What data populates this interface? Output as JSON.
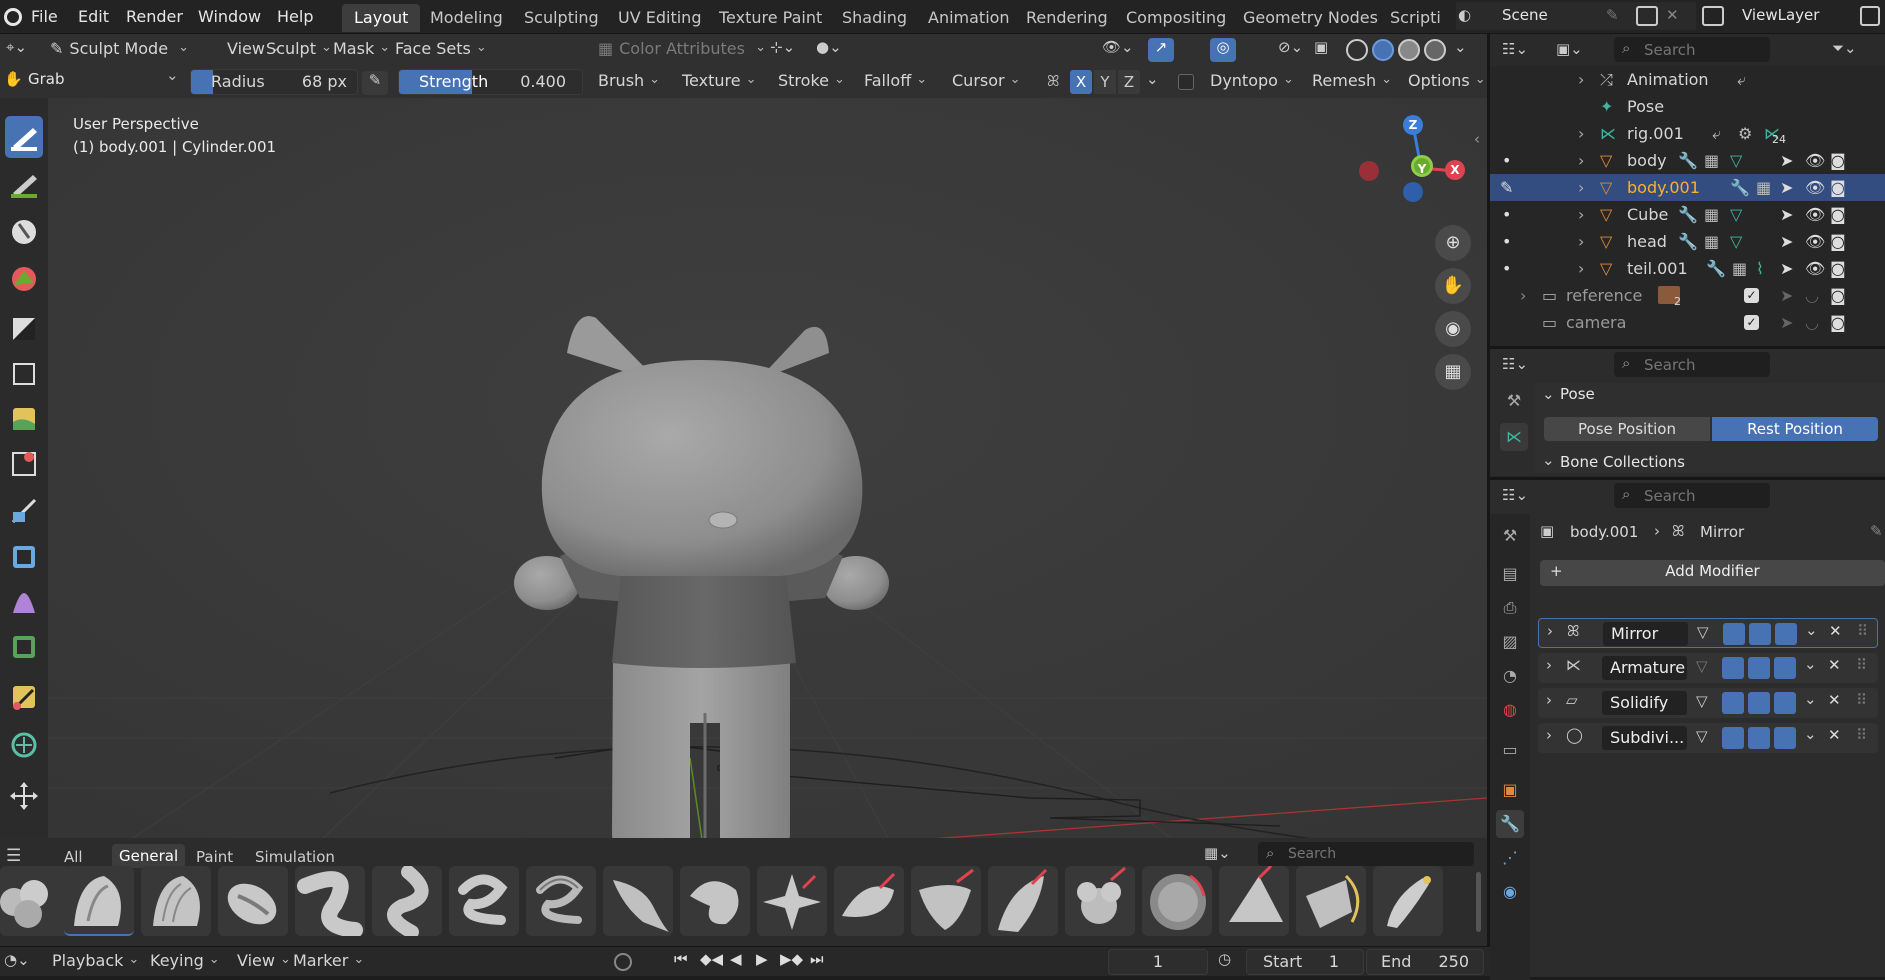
{
  "topmenu": {
    "items": [
      "File",
      "Edit",
      "Render",
      "Window",
      "Help"
    ]
  },
  "workspaces": {
    "tabs": [
      "Layout",
      "Modeling",
      "Sculpting",
      "UV Editing",
      "Texture Paint",
      "Shading",
      "Animation",
      "Rendering",
      "Compositing",
      "Geometry Nodes",
      "Scripti"
    ],
    "active": "Layout"
  },
  "scene": {
    "name": "Scene",
    "viewlayer": "ViewLayer"
  },
  "header": {
    "mode": "Sculpt Mode",
    "menus": [
      "View",
      "Sculpt",
      "Mask",
      "Face Sets"
    ],
    "color_attributes": "Color Attributes",
    "brush_name": "Grab",
    "radius_label": "Radius",
    "radius_value": "68 px",
    "strength_label": "Strength",
    "strength_value": "0.400",
    "strength_fraction": 0.4,
    "dropdowns": [
      "Brush",
      "Texture",
      "Stroke",
      "Falloff",
      "Cursor"
    ],
    "axes": [
      "X",
      "Y",
      "Z"
    ],
    "dyntopo": "Dyntopo",
    "remesh": "Remesh",
    "options": "Options"
  },
  "viewport": {
    "perspective": "User Perspective",
    "object_info": "(1) body.001 | Cylinder.001",
    "gizmo": {
      "z": "Z",
      "y": "Y",
      "x": "X"
    }
  },
  "brush_tabs": {
    "tabs": [
      "All",
      "General",
      "Paint",
      "Simulation"
    ],
    "active": "General",
    "search_placeholder": "Search"
  },
  "timeline": {
    "menus": [
      "Playback",
      "Keying",
      "View",
      "Marker"
    ],
    "current_frame": "1",
    "start_label": "Start",
    "start_value": "1",
    "end_label": "End",
    "end_value": "250"
  },
  "outliner": {
    "search_placeholder": "Search",
    "rows": [
      {
        "label": "Animation",
        "type": "anim",
        "badge": ""
      },
      {
        "label": "Pose",
        "type": "pose",
        "badge": ""
      },
      {
        "label": "rig.001",
        "type": "armature",
        "badge": "24"
      },
      {
        "label": "body",
        "type": "mesh",
        "badge": ""
      },
      {
        "label": "body.001",
        "type": "mesh",
        "badge": ""
      },
      {
        "label": "Cube",
        "type": "mesh",
        "badge": ""
      },
      {
        "label": "head",
        "type": "mesh",
        "badge": ""
      },
      {
        "label": "teil.001",
        "type": "mesh",
        "badge": ""
      },
      {
        "label": "reference",
        "type": "collection",
        "badge": "2"
      },
      {
        "label": "camera",
        "type": "collection",
        "badge": ""
      }
    ],
    "selected": "body.001"
  },
  "pose_panel": {
    "search_placeholder": "Search",
    "title": "Pose",
    "pose_position": "Pose Position",
    "rest_position": "Rest Position",
    "bone_collections": "Bone Collections"
  },
  "properties": {
    "search_placeholder": "Search",
    "object": "body.001",
    "modifier": "Mirror",
    "add_modifier": "Add Modifier",
    "modifiers": [
      "Mirror",
      "Armature",
      "Solidify",
      "Subdivi..."
    ]
  },
  "colors": {
    "accent": "#4772b3",
    "selected_text": "#ffaf29",
    "x_axis": "#e0434f",
    "y_axis": "#6aab2d",
    "z_axis": "#3b7dd8"
  }
}
